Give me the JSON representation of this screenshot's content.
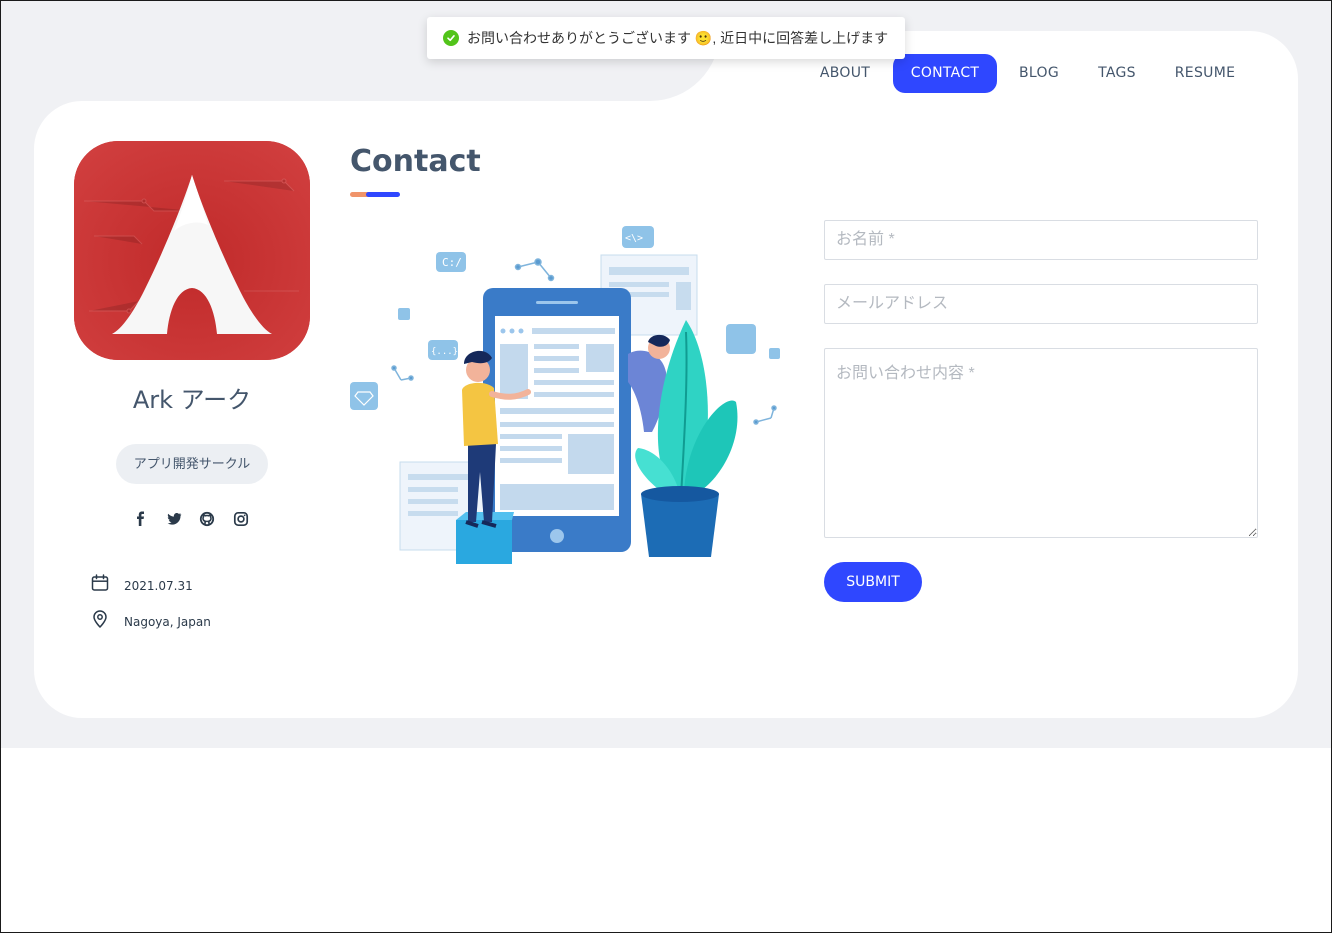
{
  "toast": {
    "message": "お問い合わせありがとうございます 🙂, 近日中に回答差し上げます"
  },
  "nav": {
    "items": [
      {
        "label": "ABOUT",
        "active": false
      },
      {
        "label": "CONTACT",
        "active": true
      },
      {
        "label": "BLOG",
        "active": false
      },
      {
        "label": "TAGS",
        "active": false
      },
      {
        "label": "RESUME",
        "active": false
      }
    ]
  },
  "profile": {
    "name": "Ark アーク",
    "badge": "アプリ開発サークル",
    "socials": [
      "facebook-icon",
      "twitter-icon",
      "github-icon",
      "instagram-icon"
    ],
    "date": "2021.07.31",
    "location": "Nagoya, Japan"
  },
  "contact": {
    "title": "Contact",
    "name_placeholder": "お名前 *",
    "email_placeholder": "メールアドレス",
    "message_placeholder": "お問い合わせ内容 *",
    "submit_label": "SUBMIT"
  },
  "colors": {
    "accent": "#2f47ff",
    "accent_orange": "#f0946a",
    "avatar_red": "#c93535",
    "success": "#52c41a",
    "page_bg": "#f0f1f4"
  }
}
